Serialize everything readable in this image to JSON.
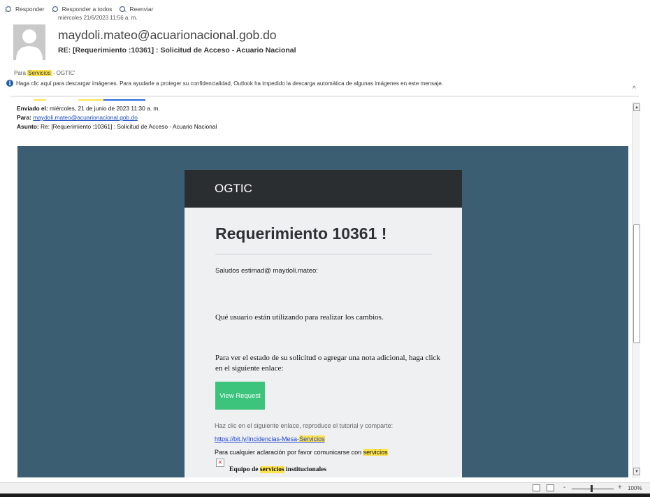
{
  "actions": [
    {
      "label": "Responder"
    },
    {
      "label": "Responder a todos"
    },
    {
      "label": "Reenviar"
    }
  ],
  "header": {
    "date": "miércoles 21/6/2023 11:56 a. m.",
    "from": "maydoli.mateo@acuarionacional.gob.do",
    "subject": "RE: [Requerimiento :10361] : Solicitud de Acceso - Acuario Nacional",
    "to_prefix": "Para",
    "to_highlight": "Servicios",
    "to_rest": " - OGTIC'"
  },
  "infobar": {
    "text": "Haga clic aquí para descargar imágenes. Para ayudarle a proteger su confidencialidad, Outlook ha impedido la descarga automática de algunas imágenes en este mensaje."
  },
  "original": {
    "sent_label": "Enviado el:",
    "sent_value": " miércoles, 21 de junio de 2023 11:30 a. m.",
    "to_label": "Para:",
    "to_value": "maydoli.mateo@acuarionacional.gob.do",
    "subject_label": "Asunto:",
    "subject_value": " Re: [Requerimiento :10361] : Solicitud de Acceso - Acuario Nacional"
  },
  "card": {
    "brand": "OGTIC",
    "title": "Requerimiento 10361 !",
    "greeting": "Saludos estimad@ maydoli.mateo:",
    "question": "Qué usuario están utilizando para realizar los cambios.",
    "instructions": "Para ver el estado de su solicitud o agregar una nota adicional, haga click en el siguiente enlace:",
    "button": "View Request",
    "tutorial": "Haz clic en el siguiente enlace, reproduce el tutorial y comparte:",
    "link_prefix": "https://bit.ly/Incidencias-Mesa-",
    "link_highlight": "Servicios",
    "contact_prefix": "Para cualquier aclaración por favor comunicarse con ",
    "contact_highlight": "servicios",
    "team_prefix": "Equipo de ",
    "team_highlight": "servicios",
    "team_suffix": " institucionales"
  },
  "statusbar": {
    "zoom_minus": "-",
    "zoom_plus": "+",
    "zoom": "100%"
  },
  "colors": {
    "background_band": "#3b5e73",
    "card_header": "#2b2e31",
    "card_body": "#eef0f1",
    "button": "#3cc47c",
    "highlight": "#ffe34d",
    "link": "#1a3fd1"
  }
}
